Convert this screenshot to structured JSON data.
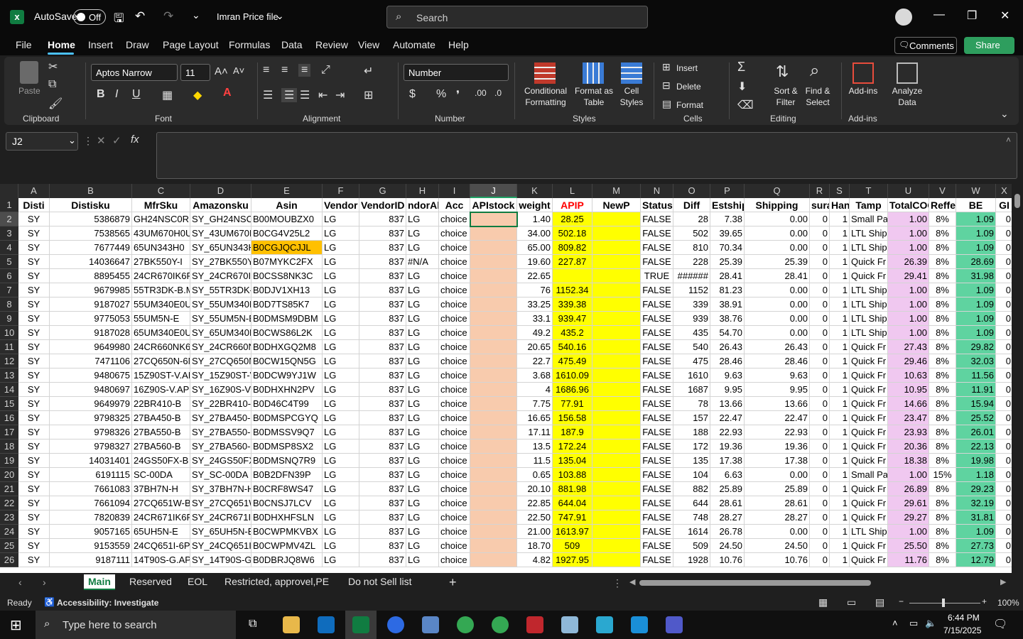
{
  "titlebar": {
    "autosave_label": "AutoSave",
    "autosave_state": "Off",
    "file_name": "Imran Price file",
    "search_placeholder": "Search"
  },
  "menu": {
    "items": [
      "File",
      "Home",
      "Insert",
      "Draw",
      "Page Layout",
      "Formulas",
      "Data",
      "Review",
      "View",
      "Automate",
      "Help"
    ],
    "active": "Home",
    "comments_label": "Comments",
    "share_label": "Share"
  },
  "ribbon": {
    "clipboard": {
      "paste": "Paste",
      "label": "Clipboard"
    },
    "font": {
      "name": "Aptos Narrow",
      "size": "11",
      "label": "Font",
      "bold": "B",
      "italic": "I",
      "underline": "U"
    },
    "alignment": {
      "label": "Alignment"
    },
    "number": {
      "format": "Number",
      "label": "Number",
      "currency": "$",
      "percent": "%"
    },
    "styles": {
      "conditional": "Conditional Formatting",
      "format_table": "Format as Table",
      "cell_styles": "Cell Styles",
      "label": "Styles"
    },
    "cells": {
      "insert": "Insert",
      "delete": "Delete",
      "format": "Format",
      "label": "Cells"
    },
    "editing": {
      "sort_filter": "Sort & Filter",
      "find_select": "Find & Select",
      "label": "Editing"
    },
    "addins": {
      "addins": "Add-ins",
      "analyze": "Analyze Data",
      "label": "Add-ins"
    }
  },
  "formula_bar": {
    "name_box": "J2",
    "fx": "fx",
    "value": ""
  },
  "columns": [
    "A",
    "B",
    "C",
    "D",
    "E",
    "F",
    "G",
    "H",
    "I",
    "J",
    "K",
    "L",
    "M",
    "N",
    "O",
    "P",
    "Q",
    "R",
    "S",
    "T",
    "U",
    "V",
    "W",
    "X"
  ],
  "header_row": [
    "Disti",
    "Distisku",
    "MfrSku",
    "Amazonsku",
    "Asin",
    "Vendor",
    "VendorID",
    "ndorAll",
    "Acc",
    "APIstock",
    "weight",
    "APIP",
    "NewP",
    "Status",
    "Diff",
    "Estship",
    "Shipping",
    "suran",
    "Han",
    "Tamp",
    "TotalCOG",
    "Reffe",
    "BE",
    "GI"
  ],
  "rows": [
    [
      "SY",
      "5386879",
      "GH24NSC0R",
      "SY_GH24NSC0",
      "B00MOUBZX0",
      "LG",
      "837",
      "LG",
      "choice",
      "",
      "1.40",
      "28.25",
      "",
      "FALSE",
      "28",
      "7.38",
      "0.00",
      "0",
      "1",
      "Small Pa",
      "1.00",
      "8%",
      "1.09",
      "0"
    ],
    [
      "SY",
      "7538565",
      "43UM670H0U",
      "SY_43UM670H",
      "B0CG4V25L2",
      "LG",
      "837",
      "LG",
      "choice",
      "",
      "34.00",
      "502.18",
      "",
      "FALSE",
      "502",
      "39.65",
      "0.00",
      "0",
      "1",
      "LTL Ship",
      "1.00",
      "8%",
      "1.09",
      "0"
    ],
    [
      "SY",
      "7677449",
      "65UN343H0",
      "SY_65UN343H",
      "B0CGJQCJJL",
      "LG",
      "837",
      "LG",
      "choice",
      "",
      "65.00",
      "809.82",
      "",
      "FALSE",
      "810",
      "70.34",
      "0.00",
      "0",
      "1",
      "LTL Ship",
      "1.00",
      "8%",
      "1.09",
      "0"
    ],
    [
      "SY",
      "14036647",
      "27BK550Y-I",
      "SY_27BK550Y-",
      "B07MYKC2FX",
      "LG",
      "837",
      "#N/A",
      "choice",
      "",
      "19.60",
      "227.87",
      "",
      "FALSE",
      "228",
      "25.39",
      "25.39",
      "0",
      "1",
      "Quick Fr",
      "26.39",
      "8%",
      "28.69",
      "0"
    ],
    [
      "SY",
      "8895455",
      "24CR670IK6P",
      "SY_24CR670IK",
      "B0CSS8NK3C",
      "LG",
      "837",
      "LG",
      "choice",
      "",
      "22.65",
      "",
      "",
      "TRUE",
      "######",
      "28.41",
      "28.41",
      "0",
      "1",
      "Quick Fr",
      "29.41",
      "8%",
      "31.98",
      "0"
    ],
    [
      "SY",
      "9679985",
      "55TR3DK-B.M",
      "SY_55TR3DK-E",
      "B0DJV1XH13",
      "LG",
      "837",
      "LG",
      "choice",
      "",
      "76",
      "1152.34",
      "",
      "FALSE",
      "1152",
      "81.23",
      "0.00",
      "0",
      "1",
      "LTL Ship",
      "1.00",
      "8%",
      "1.09",
      "0"
    ],
    [
      "SY",
      "9187027",
      "55UM340E0U",
      "SY_55UM340E",
      "B0D7TS85K7",
      "LG",
      "837",
      "LG",
      "choice",
      "",
      "33.25",
      "339.38",
      "",
      "FALSE",
      "339",
      "38.91",
      "0.00",
      "0",
      "1",
      "LTL Ship",
      "1.00",
      "8%",
      "1.09",
      "0"
    ],
    [
      "SY",
      "9775053",
      "55UM5N-E",
      "SY_55UM5N-E",
      "B0DMSM9DBM",
      "LG",
      "837",
      "LG",
      "choice",
      "",
      "33.1",
      "939.47",
      "",
      "FALSE",
      "939",
      "38.76",
      "0.00",
      "0",
      "1",
      "LTL Ship",
      "1.00",
      "8%",
      "1.09",
      "0"
    ],
    [
      "SY",
      "9187028",
      "65UM340E0U",
      "SY_65UM340E",
      "B0CWS86L2K",
      "LG",
      "837",
      "LG",
      "choice",
      "",
      "49.2",
      "435.2",
      "",
      "FALSE",
      "435",
      "54.70",
      "0.00",
      "0",
      "1",
      "LTL Ship",
      "1.00",
      "8%",
      "1.09",
      "0"
    ],
    [
      "SY",
      "9649980",
      "24CR660NK6I",
      "SY_24CR660N",
      "B0DHXGQ2M8",
      "LG",
      "837",
      "LG",
      "choice",
      "",
      "20.65",
      "540.16",
      "",
      "FALSE",
      "540",
      "26.43",
      "26.43",
      "0",
      "1",
      "Quick Fr",
      "27.43",
      "8%",
      "29.82",
      "0"
    ],
    [
      "SY",
      "7471106",
      "27CQ650N-6N",
      "SY_27CQ650N",
      "B0CW15QN5G",
      "LG",
      "837",
      "LG",
      "choice",
      "",
      "22.7",
      "475.49",
      "",
      "FALSE",
      "475",
      "28.46",
      "28.46",
      "0",
      "1",
      "Quick Fr",
      "29.46",
      "8%",
      "32.03",
      "0"
    ],
    [
      "SY",
      "9480675",
      "15Z90ST-V.AP",
      "SY_15Z90ST-V",
      "B0DCW9YJ1W",
      "LG",
      "837",
      "LG",
      "choice",
      "",
      "3.68",
      "1610.09",
      "",
      "FALSE",
      "1610",
      "9.63",
      "9.63",
      "0",
      "1",
      "Quick Fr",
      "10.63",
      "8%",
      "11.56",
      "0"
    ],
    [
      "SY",
      "9480697",
      "16Z90S-V.APC",
      "SY_16Z90S-V.",
      "B0DHXHN2PV",
      "LG",
      "837",
      "LG",
      "choice",
      "",
      "4",
      "1686.96",
      "",
      "FALSE",
      "1687",
      "9.95",
      "9.95",
      "0",
      "1",
      "Quick Fr",
      "10.95",
      "8%",
      "11.91",
      "0"
    ],
    [
      "SY",
      "9649979",
      "22BR410-B",
      "SY_22BR410-B",
      "B0D46C4T99",
      "LG",
      "837",
      "LG",
      "choice",
      "",
      "7.75",
      "77.91",
      "",
      "FALSE",
      "78",
      "13.66",
      "13.66",
      "0",
      "1",
      "Quick Fr",
      "14.66",
      "8%",
      "15.94",
      "0"
    ],
    [
      "SY",
      "9798325",
      "27BA450-B",
      "SY_27BA450-E",
      "B0DMSPCGYQ",
      "LG",
      "837",
      "LG",
      "choice",
      "",
      "16.65",
      "156.58",
      "",
      "FALSE",
      "157",
      "22.47",
      "22.47",
      "0",
      "1",
      "Quick Fr",
      "23.47",
      "8%",
      "25.52",
      "0"
    ],
    [
      "SY",
      "9798326",
      "27BA550-B",
      "SY_27BA550-E",
      "B0DMSSV9Q7",
      "LG",
      "837",
      "LG",
      "choice",
      "",
      "17.11",
      "187.9",
      "",
      "FALSE",
      "188",
      "22.93",
      "22.93",
      "0",
      "1",
      "Quick Fr",
      "23.93",
      "8%",
      "26.01",
      "0"
    ],
    [
      "SY",
      "9798327",
      "27BA560-B",
      "SY_27BA560-E",
      "B0DMSP8SX2",
      "LG",
      "837",
      "LG",
      "choice",
      "",
      "13.5",
      "172.24",
      "",
      "FALSE",
      "172",
      "19.36",
      "19.36",
      "0",
      "1",
      "Quick Fr",
      "20.36",
      "8%",
      "22.13",
      "0"
    ],
    [
      "SY",
      "14031401",
      "24GS50FX-B",
      "SY_24GS50FX-",
      "B0DMSNQ7R9",
      "LG",
      "837",
      "LG",
      "choice",
      "",
      "11.5",
      "135.04",
      "",
      "FALSE",
      "135",
      "17.38",
      "17.38",
      "0",
      "1",
      "Quick Fr",
      "18.38",
      "8%",
      "19.98",
      "0"
    ],
    [
      "SY",
      "6191115",
      "SC-00DA",
      "SY_SC-00DA",
      "B0B2DFN39P",
      "LG",
      "837",
      "LG",
      "choice",
      "",
      "0.65",
      "103.88",
      "",
      "FALSE",
      "104",
      "6.63",
      "0.00",
      "0",
      "1",
      "Small Pa",
      "1.00",
      "15%",
      "1.18",
      "0"
    ],
    [
      "SY",
      "7661083",
      "37BH7N-H",
      "SY_37BH7N-H",
      "B0CRF8WS47",
      "LG",
      "837",
      "LG",
      "choice",
      "",
      "20.10",
      "881.98",
      "",
      "FALSE",
      "882",
      "25.89",
      "25.89",
      "0",
      "1",
      "Quick Fr",
      "26.89",
      "8%",
      "29.23",
      "0"
    ],
    [
      "SY",
      "7661094",
      "27CQ651W-B",
      "SY_27CQ651W",
      "B0CNSJ7LCV",
      "LG",
      "837",
      "LG",
      "choice",
      "",
      "22.85",
      "644.04",
      "",
      "FALSE",
      "644",
      "28.61",
      "28.61",
      "0",
      "1",
      "Quick Fr",
      "29.61",
      "8%",
      "32.19",
      "0"
    ],
    [
      "SY",
      "7820839",
      "24CR671IK6P",
      "SY_24CR671IK",
      "B0DHXHFSLN",
      "LG",
      "837",
      "LG",
      "choice",
      "",
      "22.50",
      "747.91",
      "",
      "FALSE",
      "748",
      "28.27",
      "28.27",
      "0",
      "1",
      "Quick Fr",
      "29.27",
      "8%",
      "31.81",
      "0"
    ],
    [
      "SY",
      "9057165",
      "65UH5N-E",
      "SY_65UH5N-E",
      "B0CWPMKVBX",
      "LG",
      "837",
      "LG",
      "choice",
      "",
      "21.00",
      "1613.97",
      "",
      "FALSE",
      "1614",
      "26.78",
      "0.00",
      "0",
      "1",
      "LTL Ship",
      "1.00",
      "8%",
      "1.09",
      "0"
    ],
    [
      "SY",
      "9153559",
      "24CQ651I-6P",
      "SY_24CQ651I-",
      "B0CWPMV4ZL",
      "LG",
      "837",
      "LG",
      "choice",
      "",
      "18.70",
      "509",
      "",
      "FALSE",
      "509",
      "24.50",
      "24.50",
      "0",
      "1",
      "Quick Fr",
      "25.50",
      "8%",
      "27.73",
      "0"
    ],
    [
      "SY",
      "9187111",
      "14T90S-G.APE",
      "SY_14T90S-G.",
      "B0DBRJQ8W6",
      "LG",
      "837",
      "LG",
      "choice",
      "",
      "4.82",
      "1927.95",
      "",
      "FALSE",
      "1928",
      "10.76",
      "10.76",
      "0",
      "1",
      "Quick Fr",
      "11.76",
      "8%",
      "12.79",
      "0"
    ]
  ],
  "sheets": {
    "tabs": [
      "Main",
      "Reserved",
      "EOL",
      "Restricted, approvel,PE",
      "Do not Sell list"
    ],
    "active": "Main"
  },
  "status": {
    "ready": "Ready",
    "accessibility": "Accessibility: Investigate",
    "zoom": "100%"
  },
  "taskbar": {
    "search_placeholder": "Type here to search",
    "time": "6:44 PM",
    "date": "7/15/2025"
  },
  "colors": {
    "excel_green": "#107c41",
    "share_green": "#2e9e5e",
    "apip_yellow": "#ffff00",
    "apistock_salmon": "#f8cbad",
    "totalcog_pink": "#f0c8f0",
    "be_green": "#5fd3a0"
  }
}
